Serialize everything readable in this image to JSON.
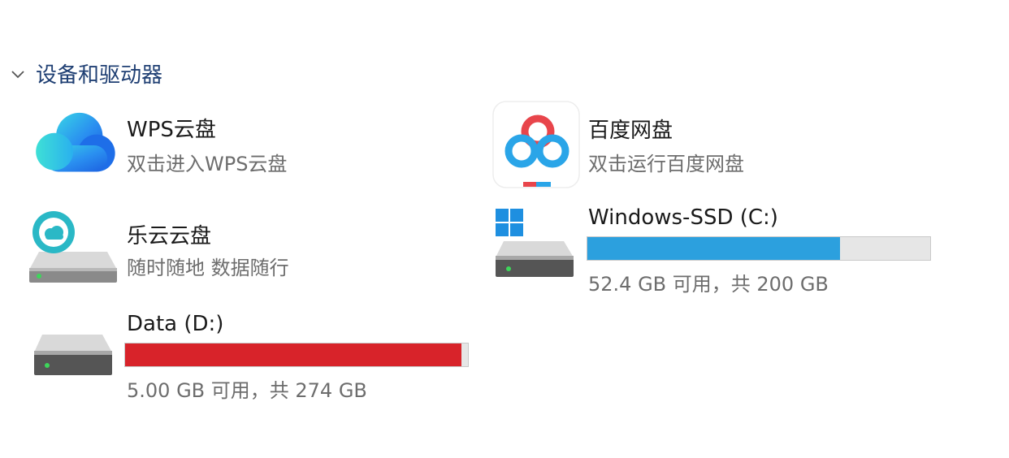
{
  "section": {
    "title": "设备和驱动器"
  },
  "items": [
    {
      "title": "WPS云盘",
      "subtitle": "双击进入WPS云盘",
      "icon": "wps-cloud-icon"
    },
    {
      "title": "百度网盘",
      "subtitle": "双击运行百度网盘",
      "icon": "baidu-netdisk-icon"
    },
    {
      "title": "乐云云盘",
      "subtitle": "随时随地 数据随行",
      "icon": "leyun-cloud-drive-icon"
    }
  ],
  "drives": [
    {
      "title": "Windows-SSD (C:)",
      "usage": "52.4 GB 可用，共 200 GB",
      "used_fraction": 0.738,
      "color": "#2ca0de",
      "icon": "windows-drive-icon"
    },
    {
      "title": "Data (D:)",
      "usage": "5.00 GB 可用，共 274 GB",
      "used_fraction": 0.982,
      "color": "#d8232a",
      "icon": "hard-drive-icon"
    }
  ]
}
